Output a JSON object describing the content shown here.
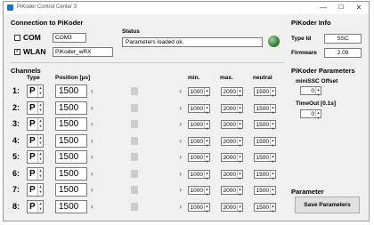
{
  "window": {
    "title": "PiKoder Control Center 3",
    "min": "—",
    "max": "☐",
    "close": "✕"
  },
  "connection": {
    "title": "Connection to PiKoder",
    "com_label": "COM",
    "com_value": "COM3",
    "com_checked": false,
    "wlan_label": "WLAN",
    "wlan_value": "PiKoder_wRX",
    "wlan_checked": true,
    "status_label": "Status",
    "status_value": "Parameters loaded ok.",
    "led_color": "#3a7d3a"
  },
  "info": {
    "title": "PiKoder Info",
    "type_label": "Type Id",
    "type_value": "SSC",
    "firmware_label": "Firmware",
    "firmware_value": "2.09"
  },
  "channels": {
    "title": "Channels",
    "headers": {
      "type": "Type",
      "position": "Position [µs]",
      "min": "min.",
      "max": "max.",
      "neutral": "neutral"
    },
    "rows": [
      {
        "num": "1:",
        "type": "P",
        "position": "1500",
        "min": "1000",
        "max": "2000",
        "neutral": "1500"
      },
      {
        "num": "2:",
        "type": "P",
        "position": "1500",
        "min": "1000",
        "max": "2000",
        "neutral": "1500"
      },
      {
        "num": "3:",
        "type": "P",
        "position": "1500",
        "min": "1000",
        "max": "2000",
        "neutral": "1500"
      },
      {
        "num": "4:",
        "type": "P",
        "position": "1500",
        "min": "1000",
        "max": "2000",
        "neutral": "1500"
      },
      {
        "num": "5:",
        "type": "P",
        "position": "1500",
        "min": "1000",
        "max": "2000",
        "neutral": "1500"
      },
      {
        "num": "6:",
        "type": "P",
        "position": "1500",
        "min": "1000",
        "max": "2000",
        "neutral": "1500"
      },
      {
        "num": "7:",
        "type": "P",
        "position": "1500",
        "min": "1000",
        "max": "2000",
        "neutral": "1500"
      },
      {
        "num": "8:",
        "type": "P",
        "position": "1500",
        "min": "1000",
        "max": "2000",
        "neutral": "1500"
      }
    ]
  },
  "params": {
    "title": "PiKoder Parameters",
    "offset_label": "miniSSC Offset",
    "offset_value": "0",
    "timeout_label": "TimeOut [0.1s]",
    "timeout_value": "0"
  },
  "parameter": {
    "title": "Parameter",
    "save_label": "Save Parameters"
  },
  "icons": {
    "spin_up": "▲",
    "spin_down": "▼",
    "scroll_left": "‹",
    "scroll_right": "›",
    "check": "✓"
  }
}
